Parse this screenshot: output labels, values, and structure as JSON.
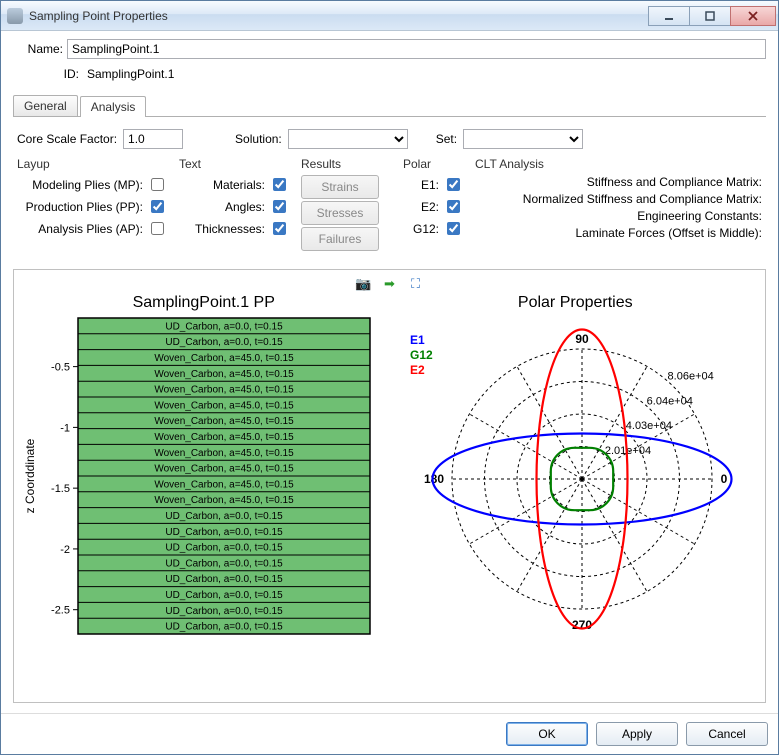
{
  "window": {
    "title": "Sampling Point Properties"
  },
  "labels": {
    "name": "Name:",
    "id": "ID:",
    "core_scale": "Core Scale Factor:",
    "solution": "Solution:",
    "set": "Set:"
  },
  "fields": {
    "name": "SamplingPoint.1",
    "id": "SamplingPoint.1",
    "core_scale": "1.0",
    "solution": "",
    "set": ""
  },
  "tabs": {
    "general": "General",
    "analysis": "Analysis"
  },
  "groups": {
    "layup": {
      "title": "Layup",
      "mp": "Modeling Plies (MP):",
      "pp": "Production Plies (PP):",
      "ap": "Analysis Plies (AP):"
    },
    "text": {
      "title": "Text",
      "materials": "Materials:",
      "angles": "Angles:",
      "thicknesses": "Thicknesses:"
    },
    "results": {
      "title": "Results",
      "strains": "Strains",
      "stresses": "Stresses",
      "failures": "Failures"
    },
    "polar": {
      "title": "Polar",
      "e1": "E1:",
      "e2": "E2:",
      "g12": "G12:"
    },
    "clt": {
      "title": "CLT Analysis",
      "r1": "Stiffness and Compliance Matrix:",
      "r2": "Normalized Stiffness and Compliance Matrix:",
      "r3": "Engineering Constants:",
      "r4": "Laminate Forces (Offset is Middle):"
    }
  },
  "buttons": {
    "ok": "OK",
    "apply": "Apply",
    "cancel": "Cancel"
  },
  "chart_data": [
    {
      "type": "table",
      "title": "SamplingPoint.1 PP",
      "ylabel": "z Coorddinate",
      "yticks": [
        -0.5,
        -1,
        -1.5,
        -2,
        -2.5
      ],
      "rows": [
        "UD_Carbon, a=0.0, t=0.15",
        "UD_Carbon, a=0.0, t=0.15",
        "Woven_Carbon, a=45.0, t=0.15",
        "Woven_Carbon, a=45.0, t=0.15",
        "Woven_Carbon, a=45.0, t=0.15",
        "Woven_Carbon, a=45.0, t=0.15",
        "Woven_Carbon, a=45.0, t=0.15",
        "Woven_Carbon, a=45.0, t=0.15",
        "Woven_Carbon, a=45.0, t=0.15",
        "Woven_Carbon, a=45.0, t=0.15",
        "Woven_Carbon, a=45.0, t=0.15",
        "Woven_Carbon, a=45.0, t=0.15",
        "UD_Carbon, a=0.0, t=0.15",
        "UD_Carbon, a=0.0, t=0.15",
        "UD_Carbon, a=0.0, t=0.15",
        "UD_Carbon, a=0.0, t=0.15",
        "UD_Carbon, a=0.0, t=0.15",
        "UD_Carbon, a=0.0, t=0.15",
        "UD_Carbon, a=0.0, t=0.15",
        "UD_Carbon, a=0.0, t=0.15"
      ]
    },
    {
      "type": "polar",
      "title": "Polar Properties",
      "legend": [
        "E1",
        "G12",
        "E2"
      ],
      "legend_colors": [
        "#0000ff",
        "#008000",
        "#ff0000"
      ],
      "angle_ticks": [
        0,
        90,
        180,
        270
      ],
      "radial_ticks": [
        "2.01e+04",
        "4.03e+04",
        "6.04e+04",
        "8.06e+04"
      ],
      "series": {
        "E1": {
          "major_axis_deg": 0,
          "r_max": 80600,
          "r_min": 10000
        },
        "E2": {
          "major_axis_deg": 90,
          "r_max": 80600,
          "r_min": 10000
        },
        "G12": {
          "r": 17000,
          "shape": "near-circle"
        }
      }
    }
  ]
}
